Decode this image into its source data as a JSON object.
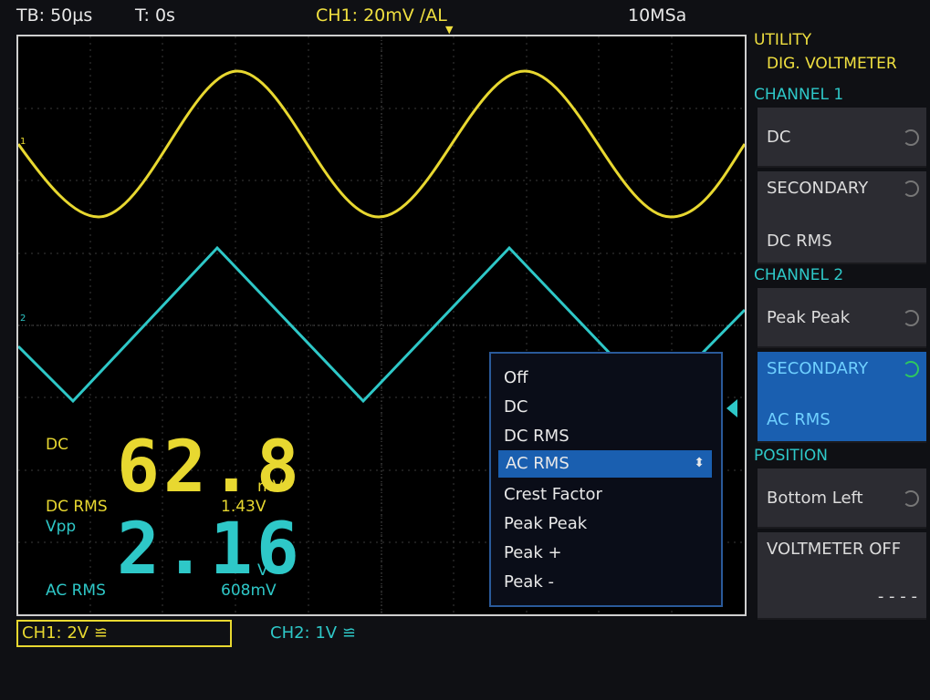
{
  "topbar": {
    "timebase": "TB: 50µs",
    "trigger_time": "T: 0s",
    "trigger_source": "CH1: 20mV /AL",
    "sample_rate": "10MSa"
  },
  "colors": {
    "ch1": "#e8d830",
    "ch2": "#2ec8c8",
    "accent": "#1a5fb0"
  },
  "measurements": {
    "ch1_primary_label": "DC",
    "ch1_primary_value": "62.8",
    "ch1_primary_unit": "mV",
    "ch1_secondary_label": "DC RMS",
    "ch1_secondary_value": "1.43V",
    "ch2_primary_label": "Vpp",
    "ch2_primary_value": "2.16",
    "ch2_primary_unit": "V",
    "ch2_secondary_label": "AC RMS",
    "ch2_secondary_value": "608mV"
  },
  "popup": {
    "items": [
      "Off",
      "DC",
      "DC RMS",
      "AC RMS",
      "Crest Factor",
      "Peak Peak",
      "Peak +",
      "Peak -"
    ],
    "selected_index": 3
  },
  "sidebar": {
    "title": "UTILITY",
    "subtitle": "DIG. VOLTMETER",
    "channel1_header": "CHANNEL 1",
    "ch1_primary": "DC",
    "ch1_secondary_label": "SECONDARY",
    "ch1_secondary_value": "DC RMS",
    "channel2_header": "CHANNEL 2",
    "ch2_primary": "Peak Peak",
    "ch2_secondary_label": "SECONDARY",
    "ch2_secondary_value": "AC RMS",
    "position_header": "POSITION",
    "position_value": "Bottom Left",
    "off_label": "VOLTMETER OFF",
    "off_value": "- - - -"
  },
  "bottom": {
    "ch1": "CH1: 2V ≌",
    "ch2": "CH2: 1V ≌"
  }
}
